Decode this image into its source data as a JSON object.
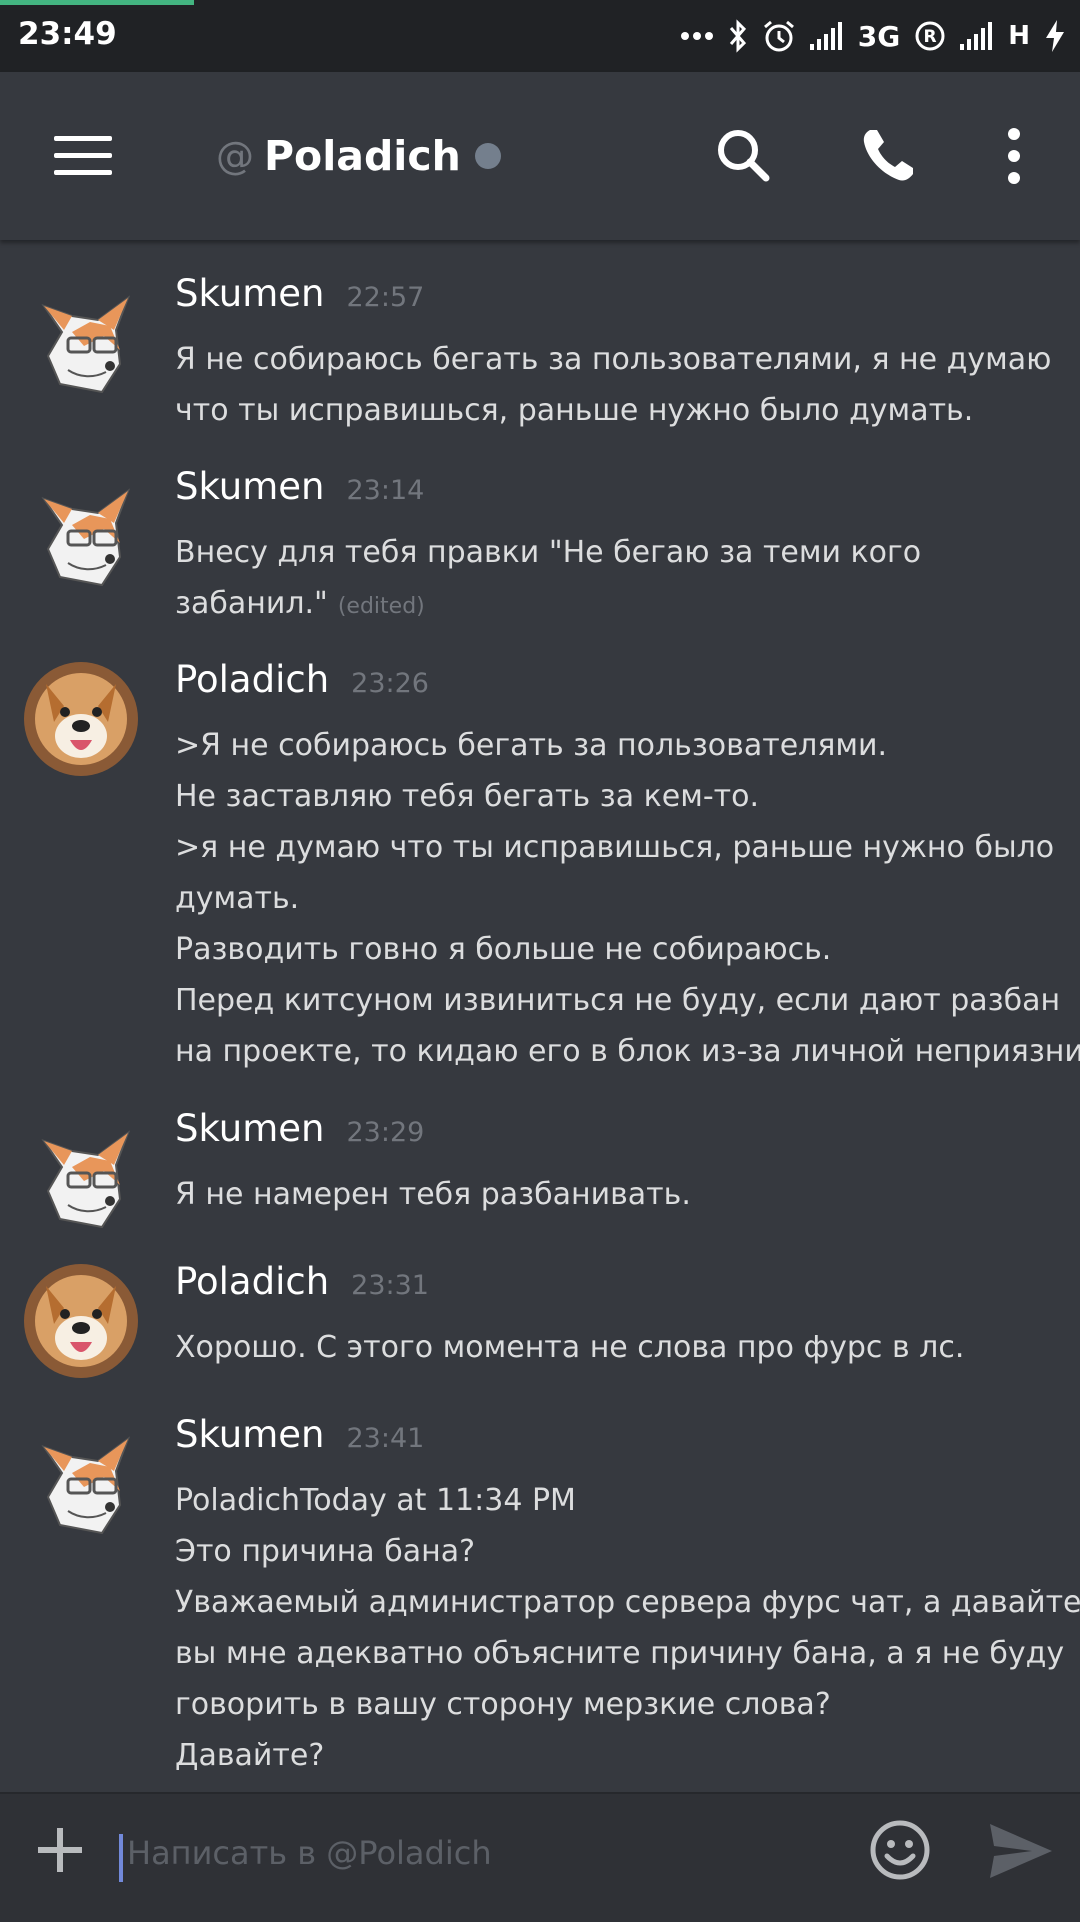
{
  "status_bar": {
    "time": "23:49",
    "network_1": "3G",
    "roaming": "R",
    "network_2": "H",
    "progress_percent": 18
  },
  "header": {
    "at": "@",
    "channel_name": "Poladich",
    "status_color": "#747f8d"
  },
  "messages": [
    {
      "author": "Skumen",
      "time": "22:57",
      "avatar": "fox-avatar",
      "lines": [
        "Я не собираюсь бегать за пользователями, я не думаю",
        "что ты исправишься, раньше нужно было думать."
      ]
    },
    {
      "author": "Skumen",
      "time": "23:14",
      "avatar": "fox-avatar",
      "lines": [
        "Внесу для тебя правки \"Не бегаю за теми кого",
        "забанил.\""
      ],
      "edited": "(edited)"
    },
    {
      "author": "Poladich",
      "time": "23:26",
      "avatar": "dog-avatar",
      "lines": [
        ">Я не собираюсь бегать за пользователями.",
        "Не заставляю тебя бегать за кем-то.",
        ">я не думаю что ты исправишься, раньше нужно было",
        "думать.",
        "Разводить говно я больше не собираюсь.",
        "Перед китсуном извиниться не буду, если дают разбан",
        "на проекте, то кидаю его в блок из-за личной неприязни"
      ]
    },
    {
      "author": "Skumen",
      "time": "23:29",
      "avatar": "fox-avatar",
      "lines": [
        "Я не намерен тебя разбанивать."
      ]
    },
    {
      "author": "Poladich",
      "time": "23:31",
      "avatar": "dog-avatar",
      "lines": [
        "Хорошо. С этого момента не слова про фурс в лс."
      ]
    },
    {
      "author": "Skumen",
      "time": "23:41",
      "avatar": "fox-avatar",
      "lines": [
        "PoladichToday at 11:34 PM",
        "Это причина бана?",
        "Уважаемый администратор сервера фурс чат, а давайте",
        "вы мне адекватно объясните причину бана, а я не буду",
        "говорить в вашу сторону мерзкие слова?",
        "Давайте?"
      ]
    }
  ],
  "composer": {
    "placeholder": "Написать в @Poladich",
    "value": ""
  },
  "icons": {
    "menu": "hamburger-icon",
    "search": "search-icon",
    "call": "phone-icon",
    "more": "more-vertical-icon",
    "add": "plus-icon",
    "emoji": "emoji-icon",
    "send": "send-icon"
  },
  "colors": {
    "background": "#36393f",
    "status_bar": "#202225",
    "composer": "#2f3136",
    "accent": "#7289da",
    "progress": "#43b581"
  }
}
